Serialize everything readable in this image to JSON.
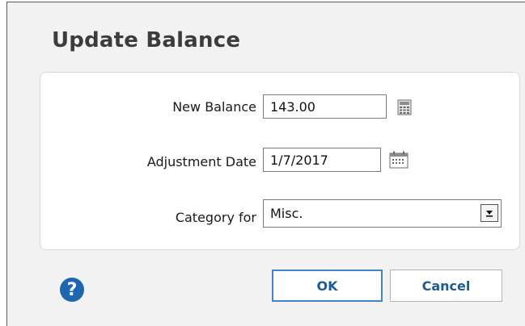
{
  "dialog": {
    "title": "Update Balance"
  },
  "form": {
    "new_balance_label": "New Balance",
    "new_balance_value": "143.00",
    "adjustment_date_label": "Adjustment Date",
    "adjustment_date_value": "1/7/2017",
    "category_label": "Category for",
    "category_value": "Misc."
  },
  "buttons": {
    "ok": "OK",
    "cancel": "Cancel",
    "help_glyph": "?"
  },
  "icons": {
    "calculator": "calculator-icon",
    "calendar": "calendar-icon",
    "dropdown": "dropdown-arrow-icon",
    "help": "help-icon"
  },
  "colors": {
    "accent": "#1e67b0",
    "button_text": "#1e5a96",
    "ok_border": "#3f86c8"
  }
}
